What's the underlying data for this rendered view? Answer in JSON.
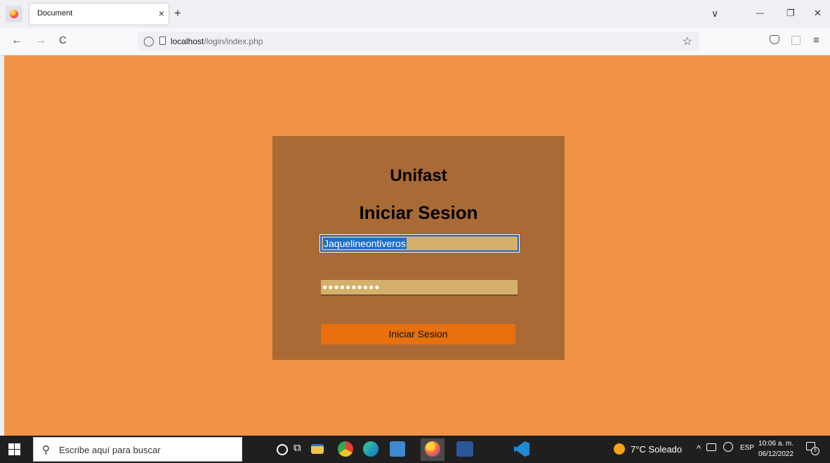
{
  "browser": {
    "tab_title": "Document",
    "tab_close": "×",
    "new_tab": "+",
    "tab_list": "∨",
    "minimize": "—",
    "restore": "❐",
    "close": "✕",
    "back": "←",
    "forward": "→",
    "reload": "C",
    "url_host": "localhost",
    "url_path": "/login/index.php",
    "bookmark": "☆",
    "menu": "≡"
  },
  "login": {
    "brand": "Unifast",
    "heading": "Iniciar Sesion",
    "username_value": "Jaquelineontiveros",
    "password_mask": "●●●●●●●●●●",
    "submit_label": "Iniciar Sesion"
  },
  "taskbar": {
    "search_placeholder": "Escribe aquí para buscar",
    "weather": "7°C Soleado",
    "language": "ESP",
    "time": "10:06 a. m.",
    "date": "06/12/2022",
    "notification_count": "5"
  },
  "colors": {
    "page_bg": "#f09347",
    "box_bg": "#a96a35",
    "input_bg": "#d4b06a",
    "button_bg": "#e8700f"
  }
}
